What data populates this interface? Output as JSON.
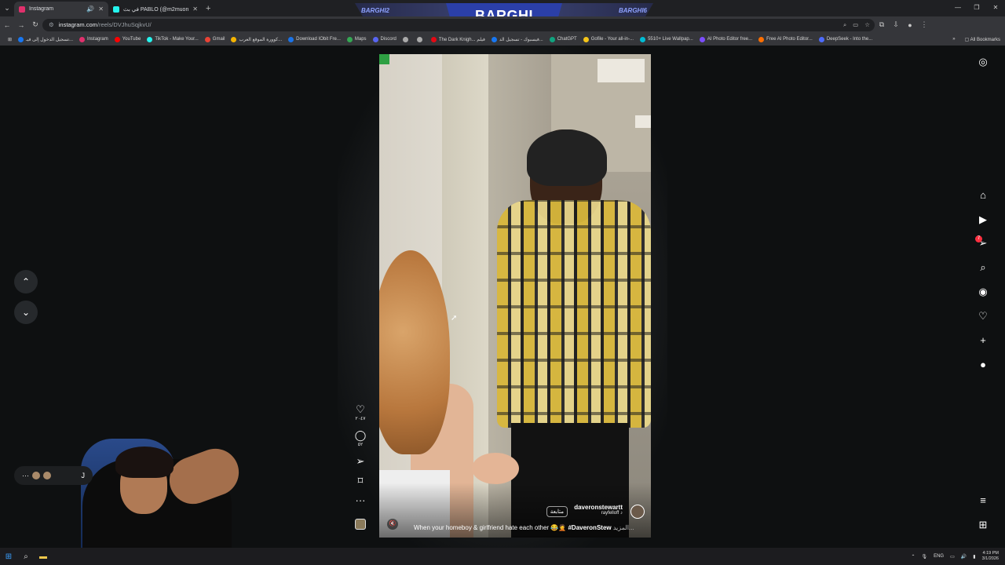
{
  "browser": {
    "tabs": [
      {
        "title": "Instagram",
        "active": true,
        "favicon_color": "#e1306c"
      },
      {
        "title": "في بث PABLO (@m2muon)",
        "active": false,
        "favicon_color": "#25f4ee"
      }
    ],
    "new_tab_icon": "plus-icon",
    "url_domain": "instagram.com",
    "url_path": "/reels/DVJhuSqjkvU/",
    "window_controls": [
      "—",
      "❐",
      "✕"
    ]
  },
  "stream_banner": {
    "title": "BARGHI",
    "left_tag": "BARGHI2",
    "right_tag": "BARGHI6"
  },
  "bookmarks": [
    {
      "label": "تسجيل الدخول إلى فيـ...",
      "color": "#1877f2"
    },
    {
      "label": "Instagram",
      "color": "#e1306c"
    },
    {
      "label": "YouTube",
      "color": "#ff0000"
    },
    {
      "label": "TikTok - Make Your...",
      "color": "#25f4ee"
    },
    {
      "label": "Gmail",
      "color": "#ea4335"
    },
    {
      "label": "كوورة الموقع العرب...",
      "color": "#f4b400"
    },
    {
      "label": "Download IObit Fre...",
      "color": "#1a73e8"
    },
    {
      "label": "Maps",
      "color": "#34a853"
    },
    {
      "label": "Discord",
      "color": "#5865f2"
    },
    {
      "label": "",
      "color": "#aaaaaa"
    },
    {
      "label": "",
      "color": "#aaaaaa"
    },
    {
      "label": "The Dark Knigh... فيلم",
      "color": "#e50914"
    },
    {
      "label": "فيسبوك - تسجيل الد...",
      "color": "#1877f2"
    },
    {
      "label": "ChatGPT",
      "color": "#10a37f"
    },
    {
      "label": "Gofile - Your all-in-...",
      "color": "#f5c518"
    },
    {
      "label": "5510+ Live Wallpap...",
      "color": "#00bcd4"
    },
    {
      "label": "AI Photo Editor free...",
      "color": "#7c4dff"
    },
    {
      "label": "Free AI Photo Editor...",
      "color": "#ff6f00"
    },
    {
      "label": "DeepSeek - Into the...",
      "color": "#4d6bfe"
    }
  ],
  "all_bookmarks_label": "All Bookmarks",
  "reel": {
    "username": "daveronstewartt",
    "audio_user": "rayfelloff",
    "follow_label": "متابعة",
    "caption": "When your homeboy & girlfriend hate each other 😂🤦",
    "hashtag": "#DaveronStew",
    "more_label": "المزيد...",
    "likes": "٢٠٤٧",
    "comments": "٥٢",
    "mute_icon": "speaker-muted-icon"
  },
  "right_rail": [
    {
      "name": "instagram-logo-icon",
      "glyph": "◎"
    },
    {
      "name": "home-icon",
      "glyph": "⌂"
    },
    {
      "name": "reels-icon",
      "glyph": "▶"
    },
    {
      "name": "messages-icon",
      "glyph": "➢"
    },
    {
      "name": "search-icon",
      "glyph": "⌕"
    },
    {
      "name": "explore-icon",
      "glyph": "◉"
    },
    {
      "name": "notifications-heart-icon",
      "glyph": "♡"
    },
    {
      "name": "create-plus-icon",
      "glyph": "+"
    },
    {
      "name": "profile-avatar-icon",
      "glyph": "●"
    },
    {
      "name": "menu-icon",
      "glyph": "≡"
    },
    {
      "name": "also-from-meta-icon",
      "glyph": "⊞"
    }
  ],
  "messages_badge": "7",
  "chat_pill": {
    "text": "J",
    "more": "···"
  },
  "taskbar": {
    "lang": "ENG",
    "time": "4:19 PM",
    "date": "3/1/2026"
  }
}
